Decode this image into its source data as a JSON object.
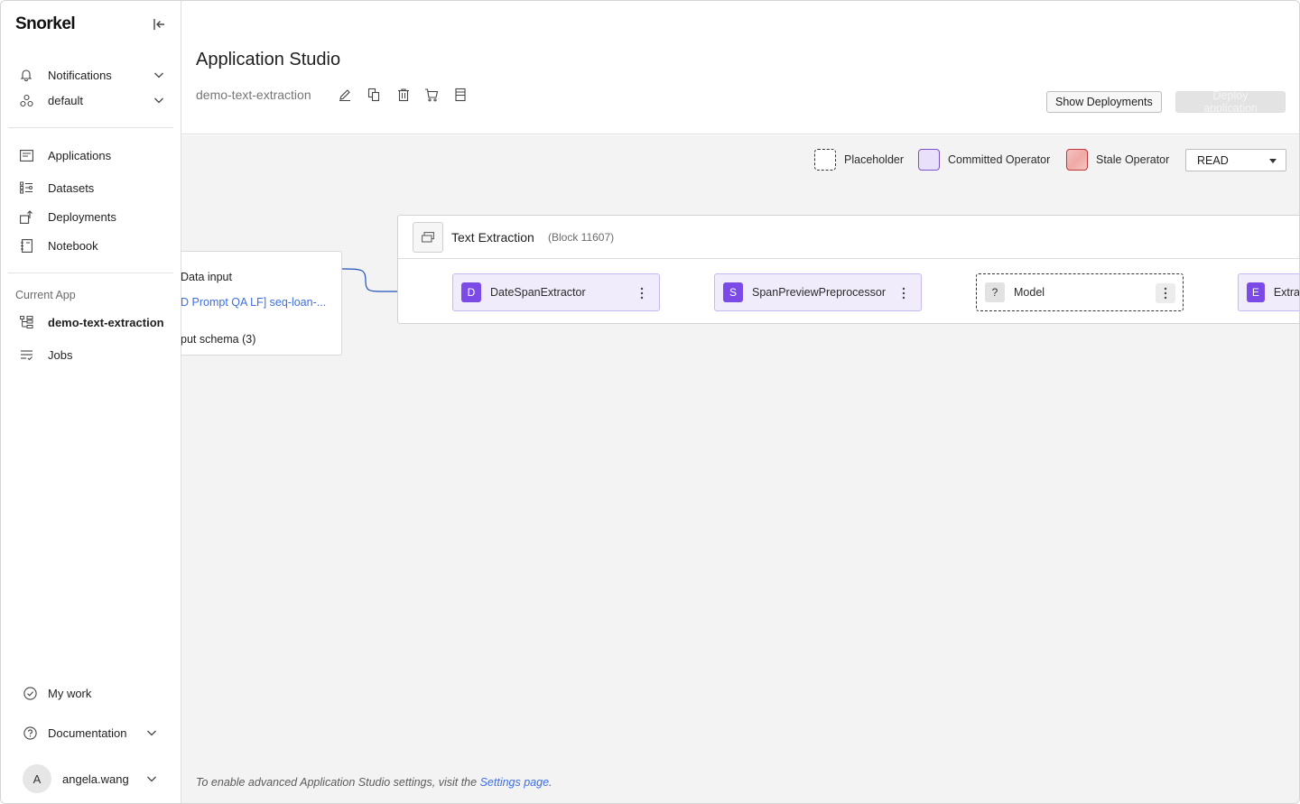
{
  "brand": {
    "logo": "Snorkel"
  },
  "sidebar": {
    "top_items": [
      {
        "label": "Notifications",
        "icon": "bell-icon"
      },
      {
        "label": "default",
        "icon": "workspace-icon"
      }
    ],
    "nav_items": [
      {
        "label": "Applications",
        "icon": "applications-icon"
      },
      {
        "label": "Datasets",
        "icon": "datasets-icon"
      },
      {
        "label": "Deployments",
        "icon": "deployments-icon"
      },
      {
        "label": "Notebook",
        "icon": "notebook-icon"
      }
    ],
    "current_app_label": "Current App",
    "current_app_items": [
      {
        "label": "demo-text-extraction",
        "icon": "app-tree-icon"
      },
      {
        "label": "Jobs",
        "icon": "jobs-icon"
      }
    ],
    "bottom_items": [
      {
        "label": "My work",
        "icon": "check-circle-icon"
      },
      {
        "label": "Documentation",
        "icon": "help-icon"
      }
    ],
    "user": {
      "initial": "A",
      "name": "angela.wang"
    }
  },
  "header": {
    "title": "Application Studio",
    "app_name": "demo-text-extraction",
    "show_deployments": "Show Deployments",
    "deploy_application": "Deploy application"
  },
  "canvas": {
    "legend": [
      {
        "label": "Placeholder"
      },
      {
        "label": "Committed Operator"
      },
      {
        "label": "Stale Operator"
      }
    ],
    "mode": "READ",
    "input_card": {
      "title": "Data input",
      "dataset": "D Prompt QA LF] seq-loan-...",
      "schema": "put schema (3)"
    },
    "block": {
      "title": "Text Extraction",
      "id": "(Block 11607)",
      "nodes": [
        {
          "badge": "D",
          "label": "DateSpanExtractor"
        },
        {
          "badge": "S",
          "label": "SpanPreviewPreprocessor"
        },
        {
          "badge": "?",
          "label": "Model"
        },
        {
          "badge": "E",
          "label": "Extra"
        }
      ]
    },
    "footnote": {
      "text": "To enable advanced Application Studio settings, visit the",
      "link": "Settings page",
      "end": "."
    }
  },
  "colors": {
    "accent_purple": "#7c4ae6",
    "link_blue": "#3d6fe0",
    "wire_blue": "#1f4fb8"
  }
}
